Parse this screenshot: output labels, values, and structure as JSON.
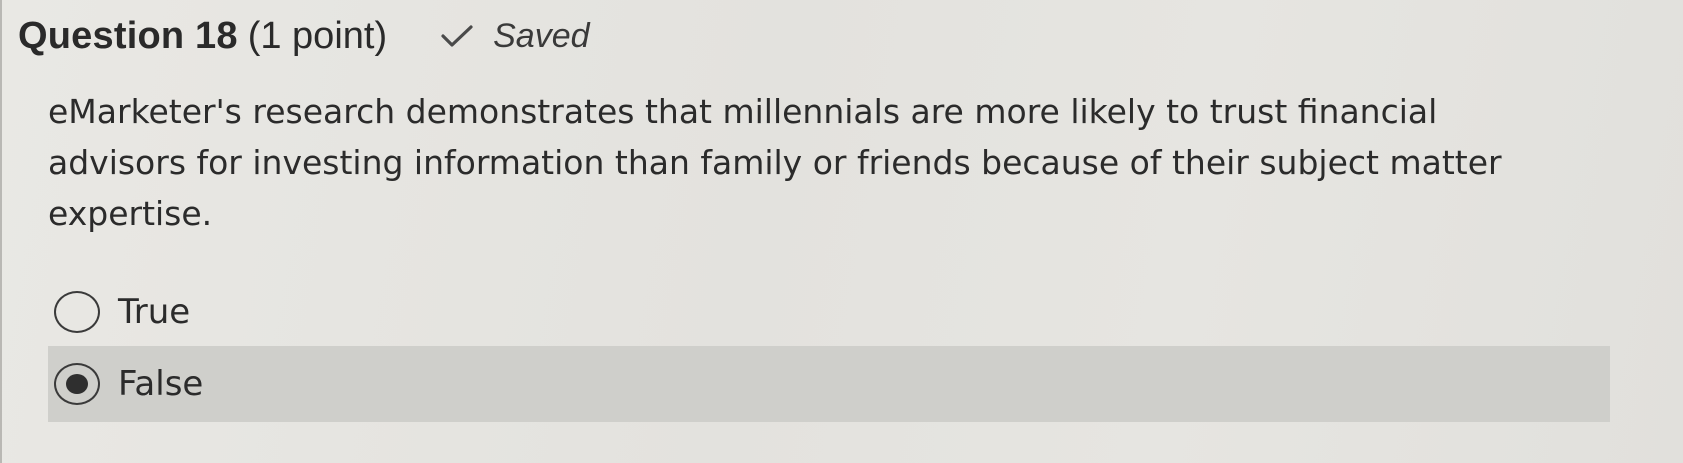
{
  "question": {
    "title": "Question 18",
    "points": "(1 point)",
    "status_icon": "checkmark-icon",
    "status": "Saved",
    "text": "eMarketer's research demonstrates that millennials are more likely to trust financial advisors for investing information than family or friends because of their subject matter expertise."
  },
  "options": [
    {
      "label": "True",
      "selected": false
    },
    {
      "label": "False",
      "selected": true
    }
  ],
  "colors": {
    "background": "#e6e5e1",
    "selected_row": "#cfcfcb",
    "text": "#2b2b2b"
  }
}
